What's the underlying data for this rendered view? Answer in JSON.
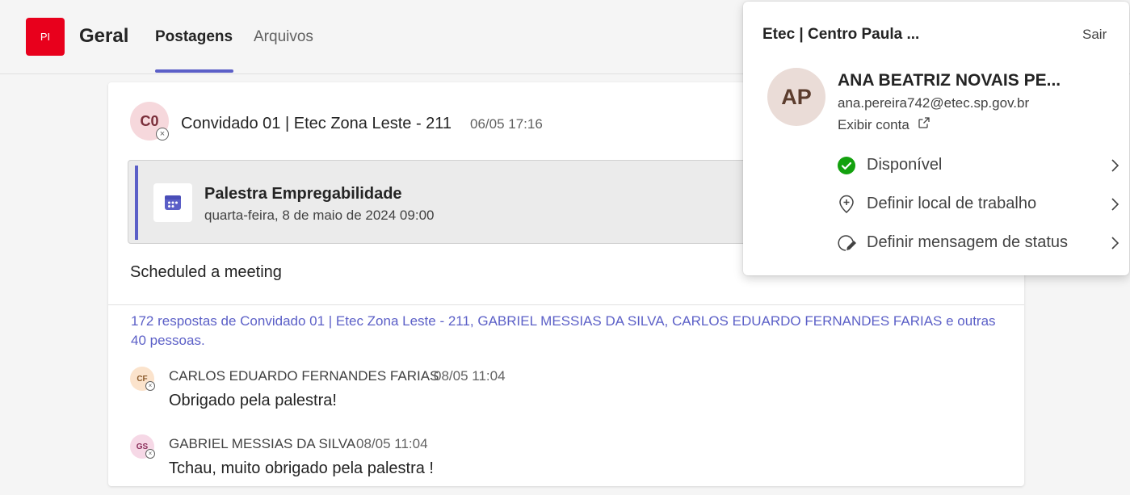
{
  "header": {
    "team_initials": "PI",
    "channel_name": "Geral",
    "tabs": [
      {
        "label": "Postagens",
        "active": true
      },
      {
        "label": "Arquivos",
        "active": false
      }
    ]
  },
  "post": {
    "author_initials": "C0",
    "author": "Convidado 01 | Etec Zona Leste - 211",
    "time": "06/05 17:16",
    "meeting": {
      "title": "Palestra Empregabilidade",
      "date": "quarta-feira, 8 de maio de 2024 09:00",
      "icon": "calendar-icon"
    },
    "message": "Scheduled a meeting",
    "replies_summary": "172 respostas de Convidado 01 | Etec Zona Leste - 211, GABRIEL MESSIAS DA SILVA, CARLOS EDUARDO FERNANDES FARIAS e outras 40 pessoas.",
    "replies": [
      {
        "initials": "CF",
        "author": "CARLOS EDUARDO FERNANDES FARIAS",
        "time": "08/05 11:04",
        "text": "Obrigado pela palestra!"
      },
      {
        "initials": "GS",
        "author": "GABRIEL MESSIAS DA SILVA",
        "time": "08/05 11:04",
        "text": "Tchau, muito obrigado pela palestra !"
      }
    ]
  },
  "profile_flyout": {
    "org_name": "Etec | Centro Paula ...",
    "signout_label": "Sair",
    "avatar_initials": "AP",
    "user_name": "ANA BEATRIZ NOVAIS PE...",
    "email": "ana.pereira742@etec.sp.gov.br",
    "view_account_label": "Exibir conta",
    "menu": [
      {
        "label": "Disponível",
        "icon": "available-status-icon"
      },
      {
        "label": "Definir local de trabalho",
        "icon": "location-pin-icon"
      },
      {
        "label": "Definir mensagem de status",
        "icon": "edit-status-icon"
      }
    ]
  },
  "colors": {
    "accent": "#5b5fc7",
    "team_avatar": "#e8001c",
    "available": "#13a10e"
  }
}
